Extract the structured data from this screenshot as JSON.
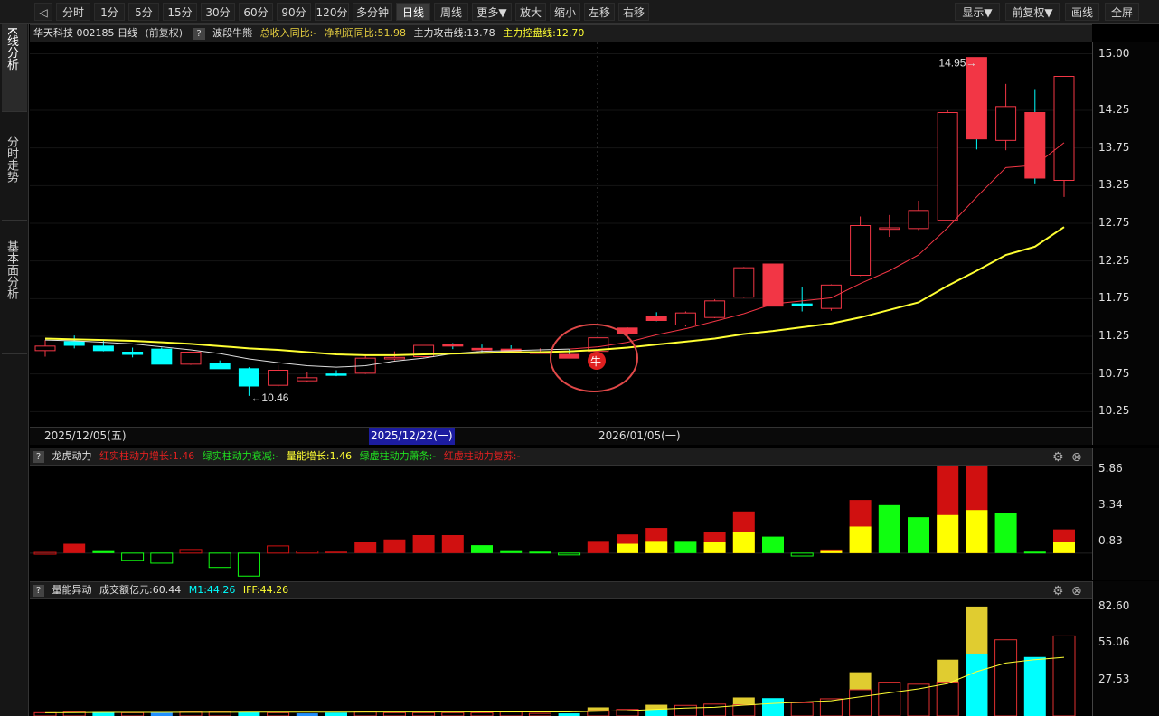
{
  "toolbar": {
    "buttons": [
      "分时",
      "1分",
      "5分",
      "15分",
      "30分",
      "60分",
      "90分",
      "120分",
      "多分钟",
      "日线",
      "周线",
      "更多▼",
      "放大",
      "缩小",
      "左移",
      "右移"
    ],
    "active": "日线",
    "right_buttons": [
      "显示▼",
      "前复权▼",
      "画线",
      "全屏"
    ]
  },
  "sidebar": {
    "tabs": [
      "K线分析",
      "分时走势",
      "基本面分析"
    ]
  },
  "main_panel": {
    "title": "华天科技 002185 日线",
    "adjust": "(前复权)",
    "indicator_name": "波段牛熊",
    "items": [
      {
        "text": "总收入同比:-",
        "color": "#e8d040"
      },
      {
        "text": "净利润同比:51.98",
        "color": "#e8d040"
      },
      {
        "text": "主力攻击线:13.78",
        "color": "#e0e0e0"
      },
      {
        "text": "主力控盘线:12.70",
        "color": "#ffff33"
      }
    ],
    "y_axis": [
      "15.00",
      "14.25",
      "13.75",
      "13.25",
      "12.75",
      "12.25",
      "11.75",
      "11.25",
      "10.75",
      "10.25"
    ],
    "high_label": "14.95",
    "low_label": "10.46",
    "signal_label": "牛"
  },
  "dates": [
    "2025/12/05(五)",
    "2025/12/22(一)",
    "2026/01/05(一)"
  ],
  "panel2": {
    "name": "龙虎动力",
    "items": [
      {
        "text": "红实柱动力增长:1.46",
        "color": "#e02020"
      },
      {
        "text": "绿实柱动力衰减:-",
        "color": "#20e020"
      },
      {
        "text": "量能增长:1.46",
        "color": "#ffff33"
      },
      {
        "text": "绿虚柱动力萧条:-",
        "color": "#20e020"
      },
      {
        "text": "红虚柱动力复苏:-",
        "color": "#e02020"
      }
    ],
    "y_axis": [
      "5.86",
      "3.34",
      "0.83"
    ]
  },
  "panel3": {
    "name": "量能异动",
    "items": [
      {
        "text": "成交额亿元:60.44",
        "color": "#e0e0e0"
      },
      {
        "text": "M1:44.26",
        "color": "#00ffff"
      },
      {
        "text": "IFF:44.26",
        "color": "#ffff33"
      }
    ],
    "y_axis": [
      "82.60",
      "55.06",
      "27.53"
    ]
  },
  "chart_data": {
    "type": "candlestick",
    "candles": [
      {
        "o": 11.06,
        "h": 11.2,
        "l": 10.98,
        "c": 11.12
      },
      {
        "o": 11.18,
        "h": 11.26,
        "l": 11.09,
        "c": 11.13
      },
      {
        "o": 11.12,
        "h": 11.2,
        "l": 11.05,
        "c": 11.06
      },
      {
        "o": 11.04,
        "h": 11.1,
        "l": 10.97,
        "c": 11.01
      },
      {
        "o": 11.08,
        "h": 11.1,
        "l": 10.88,
        "c": 10.88
      },
      {
        "o": 10.88,
        "h": 11.04,
        "l": 10.87,
        "c": 11.04
      },
      {
        "o": 10.89,
        "h": 10.93,
        "l": 10.83,
        "c": 10.82
      },
      {
        "o": 10.82,
        "h": 10.84,
        "l": 10.46,
        "c": 10.59
      },
      {
        "o": 10.6,
        "h": 10.87,
        "l": 10.58,
        "c": 10.8
      },
      {
        "o": 10.66,
        "h": 10.78,
        "l": 10.65,
        "c": 10.7
      },
      {
        "o": 10.75,
        "h": 10.8,
        "l": 10.72,
        "c": 10.74
      },
      {
        "o": 10.76,
        "h": 11.0,
        "l": 10.75,
        "c": 10.96
      },
      {
        "o": 10.95,
        "h": 11.05,
        "l": 10.93,
        "c": 10.97
      },
      {
        "o": 10.98,
        "h": 11.13,
        "l": 10.97,
        "c": 11.13
      },
      {
        "o": 11.14,
        "h": 11.16,
        "l": 11.08,
        "c": 11.12
      },
      {
        "o": 11.09,
        "h": 11.14,
        "l": 11.03,
        "c": 11.07
      },
      {
        "o": 11.08,
        "h": 11.13,
        "l": 11.03,
        "c": 11.03
      },
      {
        "o": 11.04,
        "h": 11.09,
        "l": 11.02,
        "c": 11.04
      },
      {
        "o": 11.01,
        "h": 11.08,
        "l": 10.99,
        "c": 10.96
      },
      {
        "o": 11.05,
        "h": 11.23,
        "l": 11.04,
        "c": 11.23
      },
      {
        "o": 11.29,
        "h": 11.37,
        "l": 11.25,
        "c": 11.36
      },
      {
        "o": 11.52,
        "h": 11.57,
        "l": 11.45,
        "c": 11.46
      },
      {
        "o": 11.4,
        "h": 11.58,
        "l": 11.38,
        "c": 11.56
      },
      {
        "o": 11.5,
        "h": 11.74,
        "l": 11.49,
        "c": 11.72
      },
      {
        "o": 11.77,
        "h": 12.17,
        "l": 11.76,
        "c": 12.16
      },
      {
        "o": 12.21,
        "h": 12.21,
        "l": 11.65,
        "c": 11.65
      },
      {
        "o": 11.68,
        "h": 11.9,
        "l": 11.58,
        "c": 11.66
      },
      {
        "o": 11.62,
        "h": 11.94,
        "l": 11.59,
        "c": 11.93
      },
      {
        "o": 12.06,
        "h": 12.84,
        "l": 12.05,
        "c": 12.72
      },
      {
        "o": 12.67,
        "h": 12.86,
        "l": 12.57,
        "c": 12.69
      },
      {
        "o": 12.68,
        "h": 13.05,
        "l": 12.66,
        "c": 12.92
      },
      {
        "o": 12.79,
        "h": 14.25,
        "l": 12.78,
        "c": 14.22
      },
      {
        "o": 14.95,
        "h": 14.95,
        "l": 13.73,
        "c": 13.87
      },
      {
        "o": 13.85,
        "h": 14.6,
        "l": 13.72,
        "c": 14.3
      },
      {
        "o": 14.22,
        "h": 14.52,
        "l": 13.28,
        "c": 13.35
      },
      {
        "o": 13.32,
        "h": 14.7,
        "l": 13.1,
        "c": 14.7
      }
    ],
    "ma_fast": [
      11.2,
      11.19,
      11.17,
      11.15,
      11.11,
      11.07,
      11.02,
      10.95,
      10.9,
      10.86,
      10.84,
      10.86,
      10.92,
      10.96,
      11.02,
      11.05,
      11.06,
      11.07,
      11.08,
      11.11,
      11.17,
      11.27,
      11.35,
      11.45,
      11.55,
      11.68,
      11.72,
      11.76,
      11.95,
      12.12,
      12.33,
      12.69,
      13.1,
      13.49,
      13.52,
      13.82
    ],
    "ma_slow": [
      11.22,
      11.21,
      11.2,
      11.19,
      11.17,
      11.15,
      11.12,
      11.09,
      11.07,
      11.04,
      11.01,
      11.0,
      11.0,
      11.01,
      11.02,
      11.03,
      11.04,
      11.04,
      11.05,
      11.07,
      11.1,
      11.14,
      11.18,
      11.22,
      11.28,
      11.32,
      11.37,
      11.42,
      11.5,
      11.6,
      11.7,
      11.92,
      12.12,
      12.33,
      12.44,
      12.7
    ],
    "power": [
      {
        "r": 0.05,
        "y": 0,
        "g": 0,
        "t": "rv"
      },
      {
        "r": 0.65,
        "y": 0,
        "g": 0,
        "t": "r"
      },
      {
        "r": 0,
        "y": 0,
        "g": -0.2,
        "t": "g"
      },
      {
        "r": 0,
        "y": 0,
        "g": -0.5,
        "t": "gv"
      },
      {
        "r": 0,
        "y": 0,
        "g": -0.7,
        "t": "gv"
      },
      {
        "r": 0,
        "y": 0,
        "g": -0.5,
        "t": "rv"
      },
      {
        "r": 0,
        "y": 0,
        "g": -1.0,
        "t": "gv"
      },
      {
        "r": 0,
        "y": 0,
        "g": -1.6,
        "t": "gv"
      },
      {
        "r": 0,
        "y": 0,
        "g": -1.0,
        "t": "rv"
      },
      {
        "r": 0,
        "y": 0,
        "g": -0.3,
        "t": "rv"
      },
      {
        "r": 0.1,
        "y": 0,
        "g": 0,
        "t": "r"
      },
      {
        "r": 0.75,
        "y": 0,
        "g": 0,
        "t": "r"
      },
      {
        "r": 0.95,
        "y": 0,
        "g": 0,
        "t": "r"
      },
      {
        "r": 1.25,
        "y": 0,
        "g": 0,
        "t": "r"
      },
      {
        "r": 1.25,
        "y": 0,
        "g": 0,
        "t": "r"
      },
      {
        "r": 0,
        "y": 0,
        "g": 0.55,
        "t": "g"
      },
      {
        "r": 0,
        "y": 0,
        "g": 0.2,
        "t": "g"
      },
      {
        "r": 0,
        "y": 0,
        "g": 0.1,
        "t": "g"
      },
      {
        "r": 0,
        "y": 0,
        "g": -0.1,
        "t": "gv"
      },
      {
        "r": 0.85,
        "y": 0,
        "g": 0,
        "t": "r"
      },
      {
        "r": 0.65,
        "y": 0.65,
        "g": 0,
        "t": "ry"
      },
      {
        "r": 0.9,
        "y": 0.85,
        "g": 0,
        "t": "ry"
      },
      {
        "r": 0,
        "y": 0,
        "g": 0.85,
        "t": "g"
      },
      {
        "r": 0.75,
        "y": 0.75,
        "g": 0,
        "t": "ry"
      },
      {
        "r": 1.45,
        "y": 1.45,
        "g": 0,
        "t": "ry"
      },
      {
        "r": 0,
        "y": 0,
        "g": 1.15,
        "t": "g"
      },
      {
        "r": 0,
        "y": 0,
        "g": -0.2,
        "t": "gv"
      },
      {
        "r": 0.05,
        "y": 0.2,
        "g": 0,
        "t": "ry"
      },
      {
        "r": 1.85,
        "y": 1.85,
        "g": 0,
        "t": "ry"
      },
      {
        "r": 0,
        "y": 0,
        "g": 3.34,
        "t": "g"
      },
      {
        "r": 0,
        "y": 0,
        "g": 2.5,
        "t": "g"
      },
      {
        "r": 3.45,
        "y": 2.65,
        "g": 0,
        "t": "ry"
      },
      {
        "r": 3.35,
        "y": 3.0,
        "g": 0,
        "t": "ry"
      },
      {
        "r": 0,
        "y": 0,
        "g": 2.8,
        "t": "g"
      },
      {
        "r": 0,
        "y": 0,
        "g": 0.1,
        "t": "g"
      },
      {
        "r": 0.9,
        "y": 0.75,
        "g": 0,
        "t": "ry"
      }
    ],
    "volume": [
      {
        "v": 2.5,
        "s": "rh"
      },
      {
        "v": 3.0,
        "s": "rh"
      },
      {
        "v": 3.0,
        "s": "c"
      },
      {
        "v": 2.5,
        "s": "rh"
      },
      {
        "v": 2.5,
        "s": "b"
      },
      {
        "v": 3.0,
        "s": "rh"
      },
      {
        "v": 3.0,
        "s": "rh"
      },
      {
        "v": 3.0,
        "s": "c"
      },
      {
        "v": 2.5,
        "s": "rh"
      },
      {
        "v": 2.0,
        "s": "b"
      },
      {
        "v": 2.5,
        "s": "c"
      },
      {
        "v": 3.0,
        "s": "rh"
      },
      {
        "v": 2.5,
        "s": "rh"
      },
      {
        "v": 2.5,
        "s": "rh"
      },
      {
        "v": 2.5,
        "s": "rh"
      },
      {
        "v": 2.5,
        "s": "rh"
      },
      {
        "v": 3.0,
        "s": "rh"
      },
      {
        "v": 2.0,
        "s": "rh"
      },
      {
        "v": 2.0,
        "s": "c"
      },
      {
        "v": 6.5,
        "s": "ry"
      },
      {
        "v": 5.0,
        "s": "rh"
      },
      {
        "v": 8.5,
        "s": "cy"
      },
      {
        "v": 8.0,
        "s": "rh"
      },
      {
        "v": 9.0,
        "s": "rh"
      },
      {
        "v": 14.0,
        "s": "ry"
      },
      {
        "v": 13.5,
        "s": "c"
      },
      {
        "v": 10.0,
        "s": "rh"
      },
      {
        "v": 13.0,
        "s": "rh"
      },
      {
        "v": 33.0,
        "s": "ry"
      },
      {
        "v": 25.5,
        "s": "rh"
      },
      {
        "v": 24.0,
        "s": "rh"
      },
      {
        "v": 42.5,
        "s": "ry"
      },
      {
        "v": 82.6,
        "s": "cy"
      },
      {
        "v": 57.5,
        "s": "rh"
      },
      {
        "v": 44.5,
        "s": "c"
      },
      {
        "v": 60.44,
        "s": "rh"
      }
    ],
    "m1": [
      2.5,
      2.6,
      2.7,
      2.7,
      2.7,
      2.8,
      2.8,
      2.9,
      2.9,
      2.9,
      2.9,
      3.0,
      3.0,
      3.0,
      3.0,
      3.1,
      3.1,
      3.1,
      3.1,
      3.6,
      4.0,
      5.0,
      6.0,
      6.6,
      8.2,
      9.5,
      10.5,
      11.5,
      14.5,
      17.5,
      20.5,
      24.5,
      33.5,
      40.0,
      42.5,
      44.26
    ],
    "y_range": [
      10.05,
      15.15
    ],
    "power_range": [
      -1.9,
      6.1
    ],
    "vol_range": [
      0,
      88
    ]
  }
}
